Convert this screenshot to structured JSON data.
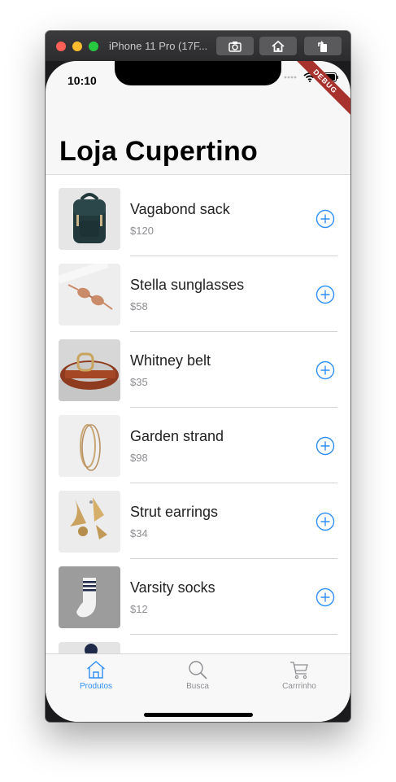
{
  "window": {
    "title": "iPhone 11 Pro (17F..."
  },
  "status_bar": {
    "time": "10:10",
    "debug_label": "DEBUG"
  },
  "nav": {
    "title": "Loja Cupertino"
  },
  "products": [
    {
      "name": "Vagabond sack",
      "price": "$120"
    },
    {
      "name": "Stella sunglasses",
      "price": "$58"
    },
    {
      "name": "Whitney belt",
      "price": "$35"
    },
    {
      "name": "Garden strand",
      "price": "$98"
    },
    {
      "name": "Strut earrings",
      "price": "$34"
    },
    {
      "name": "Varsity socks",
      "price": "$12"
    }
  ],
  "tabs": [
    {
      "label": "Produtos",
      "icon": "home-icon",
      "active": true
    },
    {
      "label": "Busca",
      "icon": "search-icon",
      "active": false
    },
    {
      "label": "Carrrinho",
      "icon": "cart-icon",
      "active": false
    }
  ],
  "colors": {
    "accent": "#2f8ef5",
    "inactive": "#8e8e93",
    "debug_banner": "#a8322e"
  }
}
